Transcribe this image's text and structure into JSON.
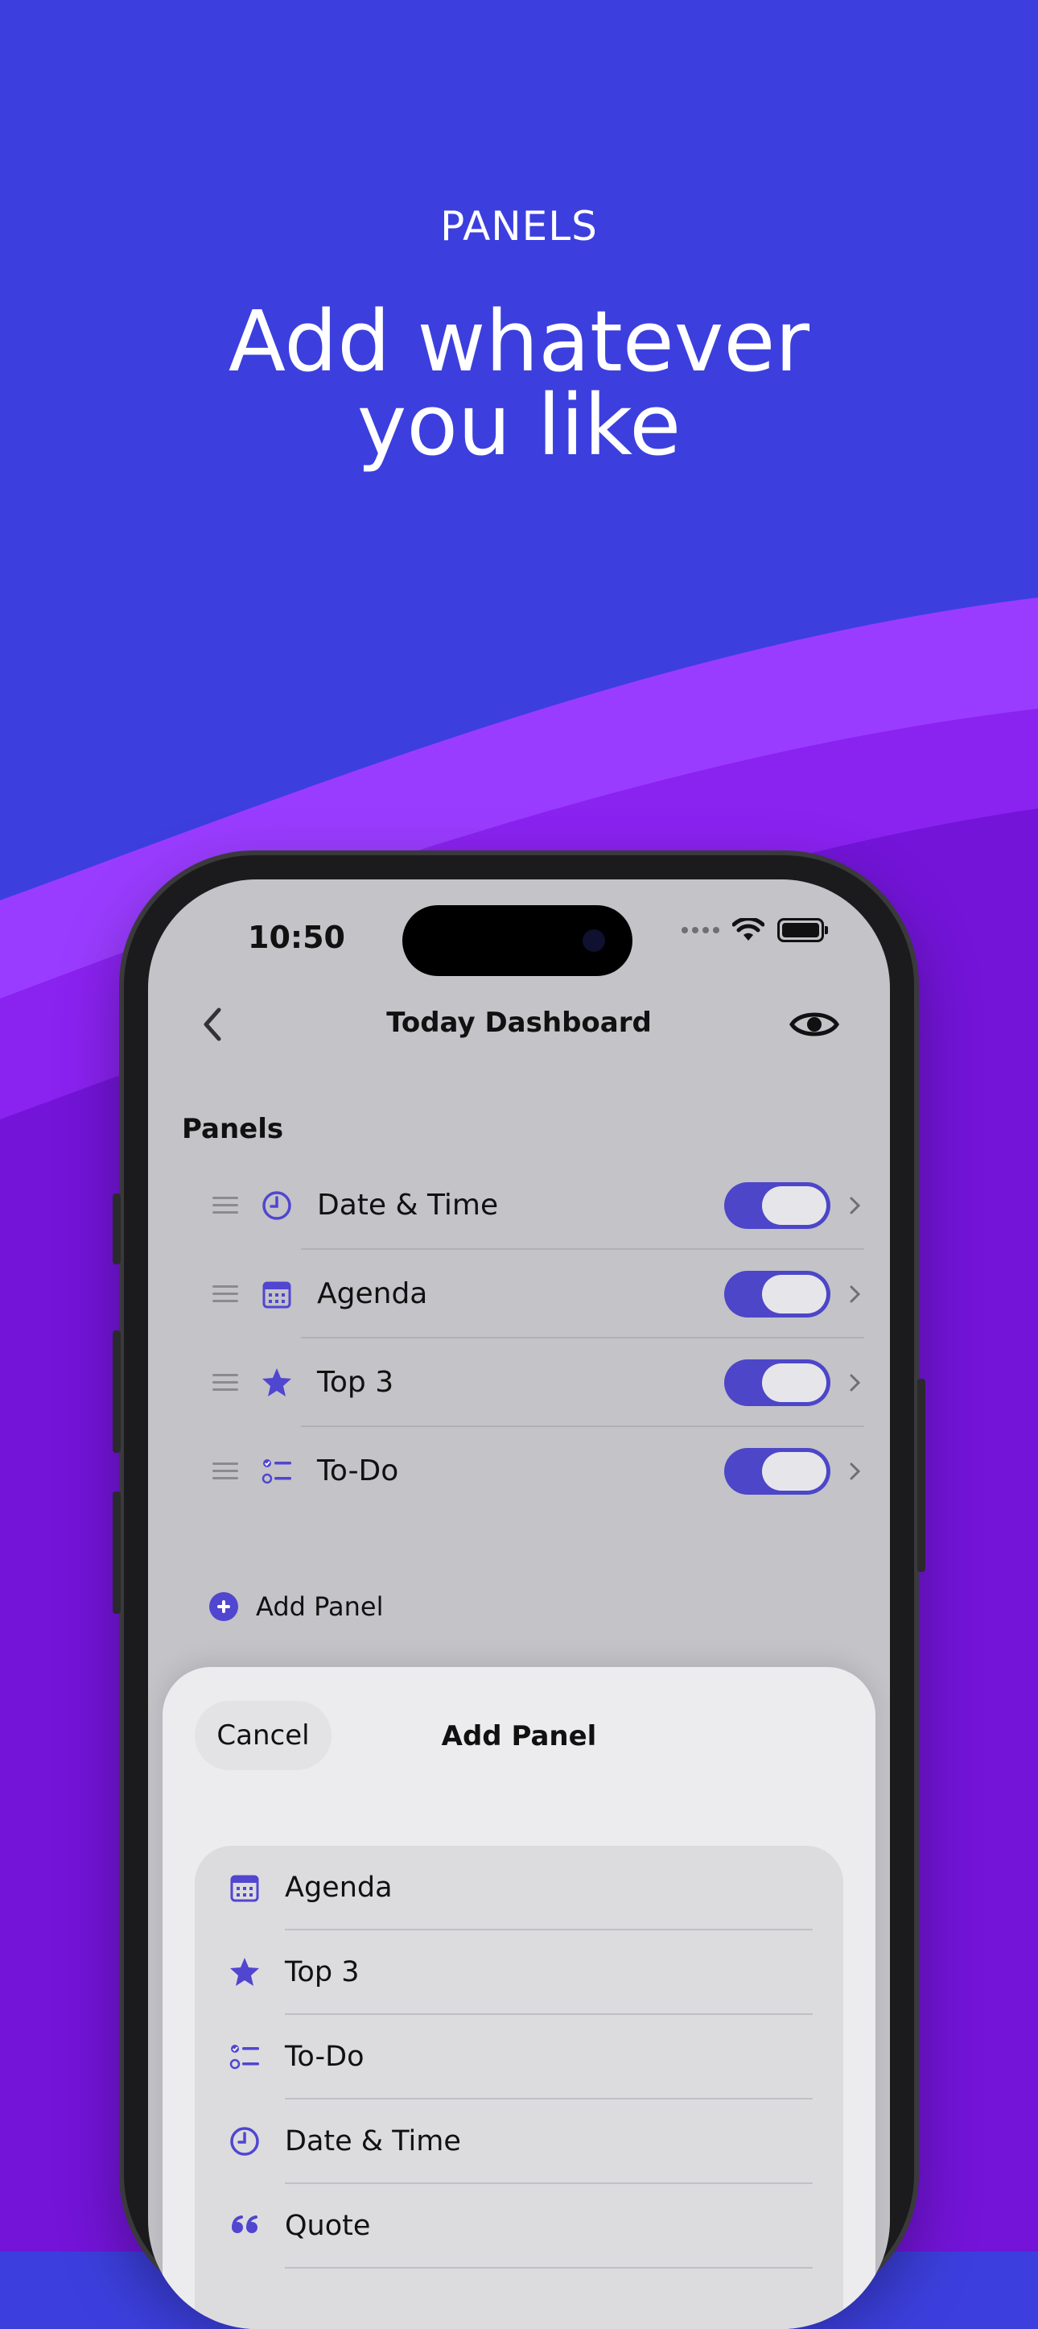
{
  "hero": {
    "eyebrow": "PANELS",
    "title_line1": "Add whatever",
    "title_line2": "you like"
  },
  "colors": {
    "background": "#3c3fdd",
    "wave_light": "#9a3cff",
    "wave_mid": "#8a22f0",
    "wave_dark": "#7314d8",
    "accent": "#4d46c8"
  },
  "status_bar": {
    "time": "10:50"
  },
  "nav": {
    "title": "Today Dashboard",
    "back_icon": "chevron-left-icon",
    "preview_icon": "eye-icon"
  },
  "panels": {
    "section_label": "Panels",
    "items": [
      {
        "label": "Date & Time",
        "icon": "clock-icon",
        "enabled": true
      },
      {
        "label": "Agenda",
        "icon": "calendar-icon",
        "enabled": true
      },
      {
        "label": "Top 3",
        "icon": "star-icon",
        "enabled": true
      },
      {
        "label": "To-Do",
        "icon": "checklist-icon",
        "enabled": true
      }
    ],
    "add_label": "Add Panel"
  },
  "sheet": {
    "cancel": "Cancel",
    "title": "Add Panel",
    "items": [
      {
        "label": "Agenda",
        "icon": "calendar-icon"
      },
      {
        "label": "Top 3",
        "icon": "star-icon"
      },
      {
        "label": "To-Do",
        "icon": "checklist-icon"
      },
      {
        "label": "Date & Time",
        "icon": "clock-icon"
      },
      {
        "label": "Quote",
        "icon": "quote-icon"
      }
    ]
  }
}
